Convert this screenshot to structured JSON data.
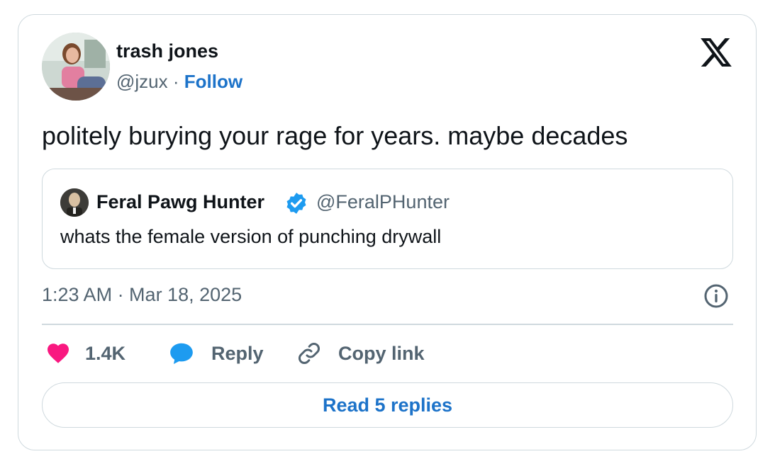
{
  "author": {
    "name": "trash jones",
    "handle": "@jzux",
    "separator": " · ",
    "follow_label": "Follow"
  },
  "tweet": {
    "text": "politely burying your rage for years. maybe decades",
    "timestamp": "1:23 AM · Mar 18, 2025"
  },
  "quoted_tweet": {
    "name": "Feral Pawg Hunter",
    "handle": "@FeralPHunter",
    "text": "whats the female version of punching drywall"
  },
  "actions": {
    "like_count": "1.4K",
    "reply_label": "Reply",
    "copy_label": "Copy link"
  },
  "read_replies_label": "Read 5 replies",
  "colors": {
    "link_blue": "#1d73c9",
    "heart_pink": "#f91880",
    "reply_blue": "#1d9bf0",
    "muted_gray": "#536471",
    "border": "#cfd9de"
  },
  "icons": [
    "x-logo-icon",
    "verified-badge-icon",
    "info-icon",
    "heart-icon",
    "reply-bubble-icon",
    "link-icon"
  ]
}
